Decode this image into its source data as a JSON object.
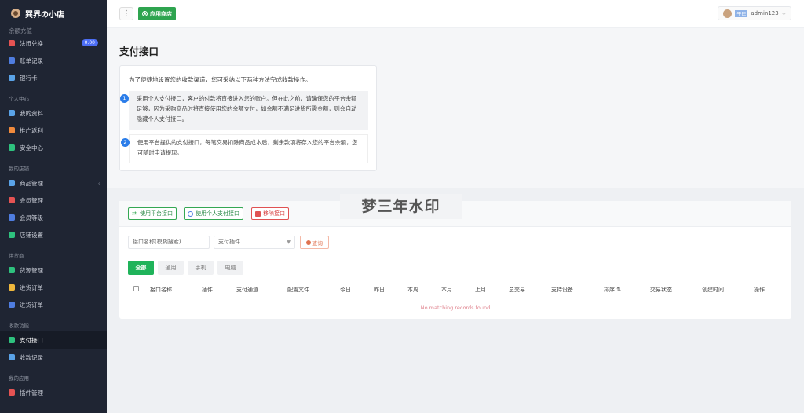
{
  "brand": {
    "name": "巽界の小店"
  },
  "sidebar": {
    "partial_top": "余额充值",
    "items_top": [
      {
        "label": "法币兑换",
        "badge": "0.00",
        "color": "#e55353"
      },
      {
        "label": "账单记录",
        "color": "#4f7de0"
      },
      {
        "label": "银行卡",
        "color": "#5aa3e8"
      }
    ],
    "sections": [
      {
        "title": "个人中心",
        "items": [
          {
            "label": "我的资料",
            "color": "#5aa3e8"
          },
          {
            "label": "推广返利",
            "color": "#f08a3c"
          },
          {
            "label": "安全中心",
            "color": "#2ec27e"
          }
        ]
      },
      {
        "title": "我的店铺",
        "items": [
          {
            "label": "商品管理",
            "color": "#5aa3e8",
            "caret": "‹"
          },
          {
            "label": "会员管理",
            "color": "#e55353"
          },
          {
            "label": "会员等级",
            "color": "#4f7de0"
          },
          {
            "label": "店铺设置",
            "color": "#2ec27e"
          }
        ]
      },
      {
        "title": "供货商",
        "items": [
          {
            "label": "货源管理",
            "color": "#2ec27e"
          },
          {
            "label": "进货订单",
            "color": "#f0b83c"
          },
          {
            "label": "进货订单",
            "color": "#4f7de0"
          }
        ]
      },
      {
        "title": "收款功能",
        "items": [
          {
            "label": "支付接口",
            "color": "#2ec27e",
            "active": true
          },
          {
            "label": "收款记录",
            "color": "#5aa3e8"
          }
        ]
      },
      {
        "title": "我的应用",
        "items": [
          {
            "label": "插件管理",
            "color": "#e55353"
          }
        ]
      }
    ]
  },
  "topbar": {
    "menu_glyph": "⋮",
    "store_label": "应用商店",
    "user_level": "平民",
    "username": "admin123",
    "chevron": "⌵"
  },
  "page": {
    "title": "支付接口",
    "intro": "为了便捷地设置您的收款渠道，您可采纳以下两种方法完成收款操作。",
    "steps": [
      {
        "num": "1",
        "text": "采用个人支付接口，客户的付款将直接进入您的账户。但在此之前，请确保您的平台余额足够，因为采购商品时将直接使用您的余额支付，如余额不满足进货所需金额，则会自动隐藏个人支付接口。"
      },
      {
        "num": "2",
        "text": "使用平台提供的支付接口，每笔交易扣除商品成本后，剩余款项将存入您的平台余额，您可随时申请提现。"
      }
    ]
  },
  "toolbar": {
    "use_platform": "使用平台接口",
    "use_personal": "使用个人支付接口",
    "remove": "移除接口"
  },
  "filters": {
    "search_placeholder": "接口名称(模糊搜索)",
    "plugin_placeholder": "支付插件",
    "query_label": "查询"
  },
  "tabs": [
    "全部",
    "通用",
    "手机",
    "电脑"
  ],
  "table": {
    "columns": [
      "接口名称",
      "插件",
      "支付通道",
      "配置文件",
      "今日",
      "昨日",
      "本周",
      "本月",
      "上月",
      "总交易",
      "支持设备",
      "排序 ⇅",
      "交易状态",
      "创建时间",
      "操作"
    ],
    "empty_text": "No matching records found"
  },
  "watermark": "梦三年水印"
}
